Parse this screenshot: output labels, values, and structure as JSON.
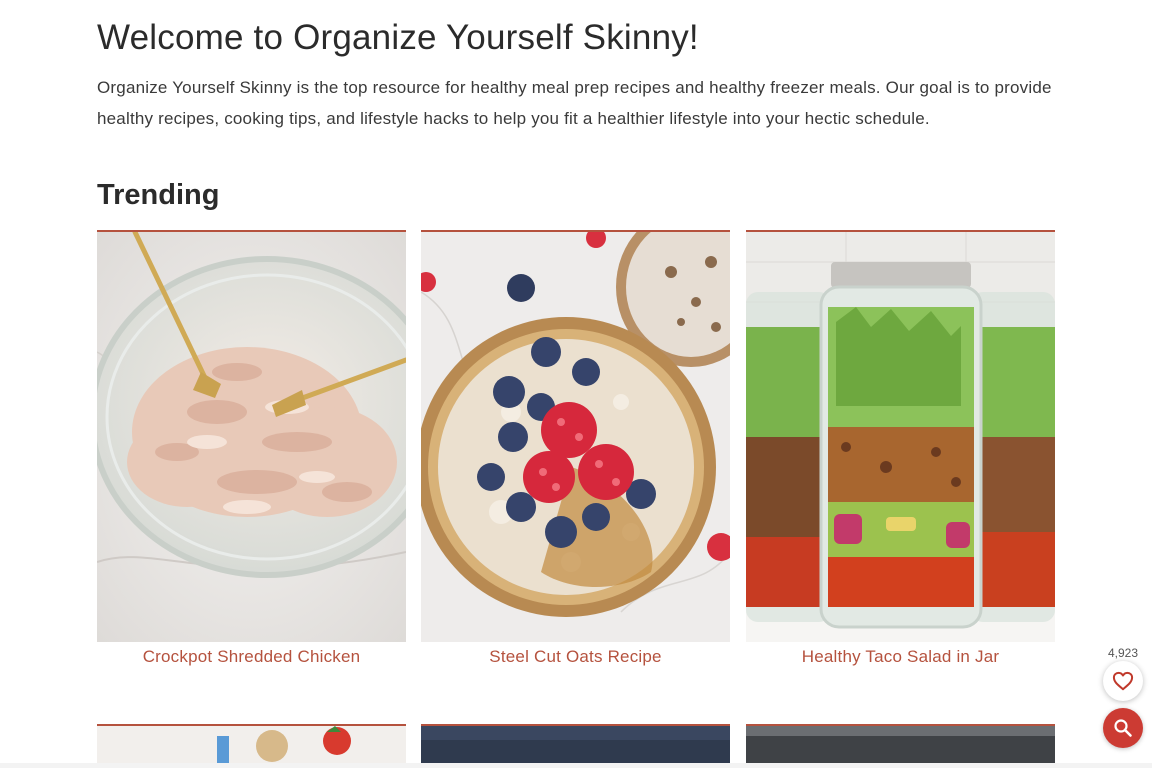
{
  "intro": {
    "title": "Welcome to Organize Yourself Skinny!",
    "description": "Organize Yourself Skinny is the top resource for healthy meal prep recipes and healthy freezer meals. Our goal is to provide healthy recipes, cooking tips, and lifestyle hacks to help you fit a healthier lifestyle into your hectic schedule."
  },
  "trending": {
    "heading": "Trending",
    "cards": [
      {
        "title": "Crockpot Shredded Chicken"
      },
      {
        "title": "Steel Cut Oats Recipe"
      },
      {
        "title": "Healthy Taco Salad in Jar"
      }
    ]
  },
  "floating": {
    "favorite_count": "4,923",
    "favorite_icon": "heart-icon",
    "search_icon": "search-icon"
  },
  "colors": {
    "accent": "#b5523e",
    "search_button": "#cc3b33"
  }
}
